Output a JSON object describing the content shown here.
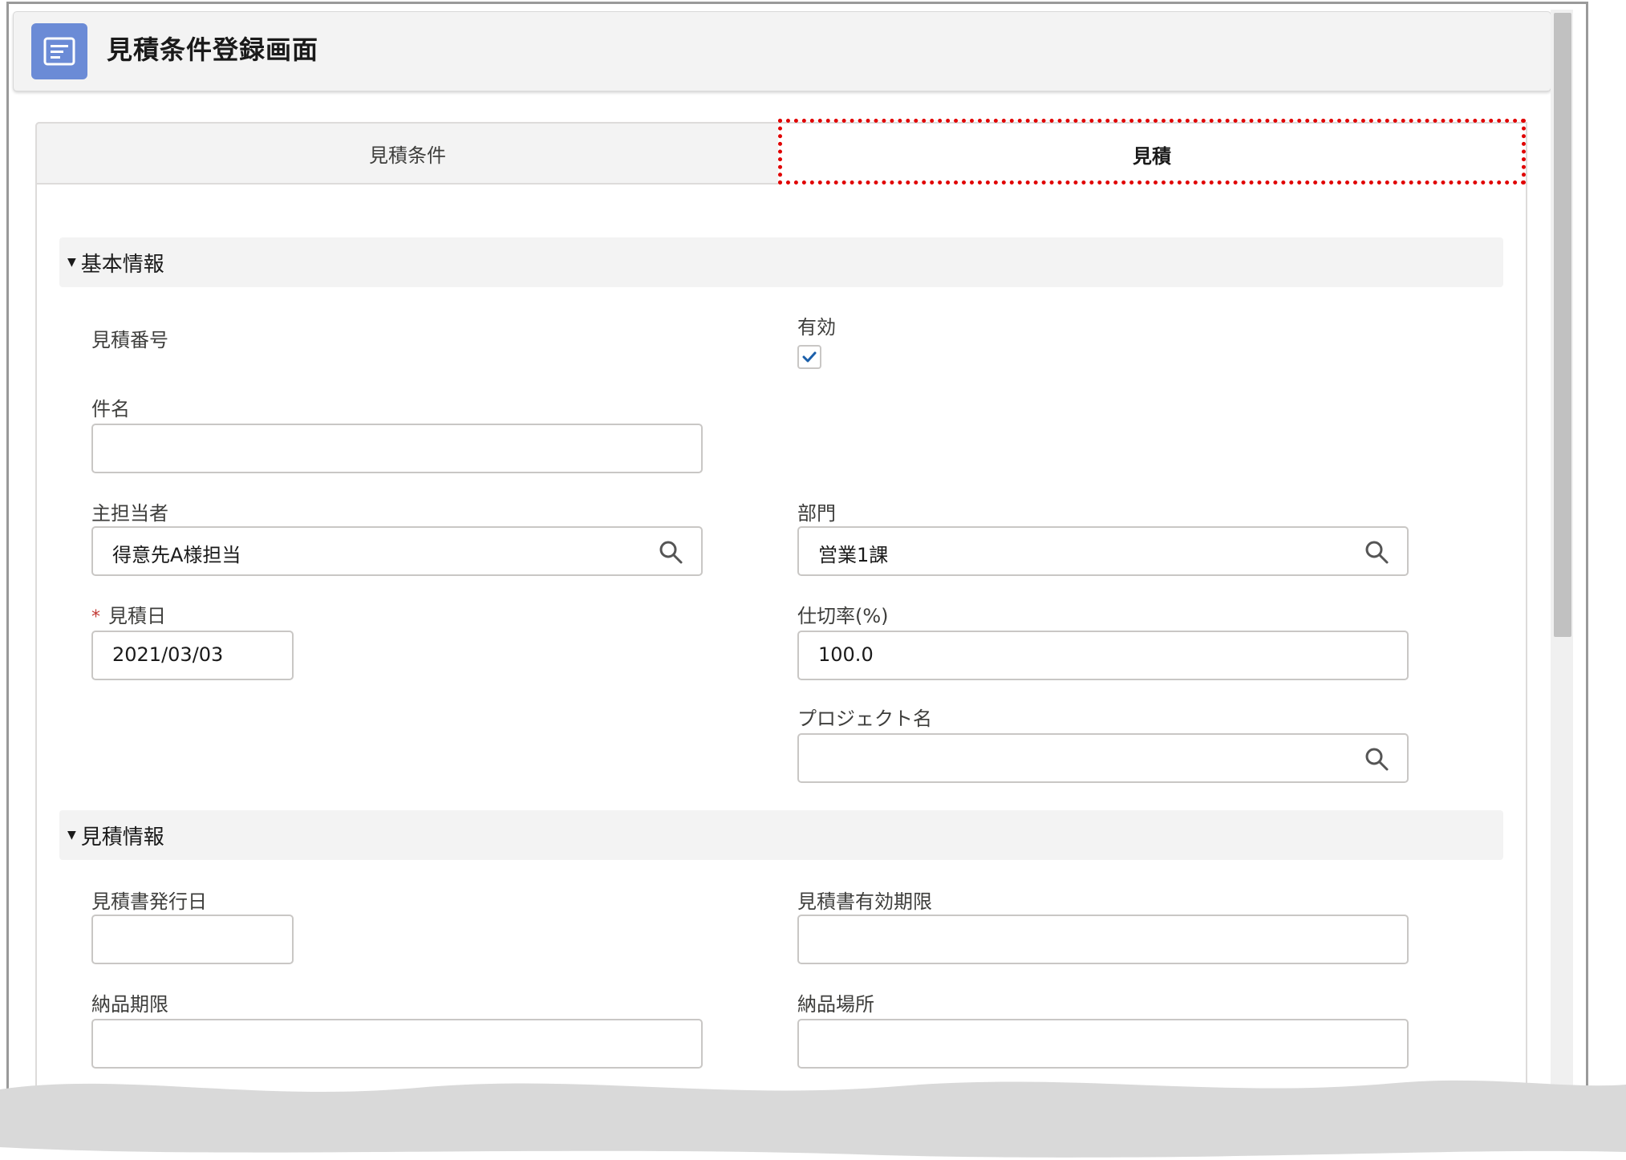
{
  "header": {
    "title": "見積条件登録画面",
    "icon": "document-icon",
    "icon_color": "#6b8bd6"
  },
  "tabs": [
    {
      "label": "見積条件",
      "active": false
    },
    {
      "label": "見積",
      "active": true
    }
  ],
  "highlight_color": "#e00000",
  "sections": {
    "basic": {
      "title": "基本情報",
      "fields": {
        "estimate_number": {
          "label": "見積番号"
        },
        "active": {
          "label": "有効",
          "checked": true
        },
        "subject": {
          "label": "件名",
          "value": ""
        },
        "owner": {
          "label": "主担当者",
          "value": "得意先A様担当",
          "icon": "search-icon"
        },
        "department": {
          "label": "部門",
          "value": "営業1課",
          "icon": "search-icon"
        },
        "estimate_date": {
          "label": "見積日",
          "required_mark": "*",
          "value": "2021/03/03"
        },
        "rate": {
          "label": "仕切率(%)",
          "value": "100.0"
        },
        "project": {
          "label": "プロジェクト名",
          "value": "",
          "icon": "search-icon"
        }
      }
    },
    "estimate": {
      "title": "見積情報",
      "fields": {
        "issue_date": {
          "label": "見積書発行日",
          "value": ""
        },
        "valid_until": {
          "label": "見積書有効期限",
          "value": ""
        },
        "delivery_deadline": {
          "label": "納品期限",
          "value": ""
        },
        "delivery_place": {
          "label": "納品場所",
          "value": ""
        }
      }
    }
  }
}
